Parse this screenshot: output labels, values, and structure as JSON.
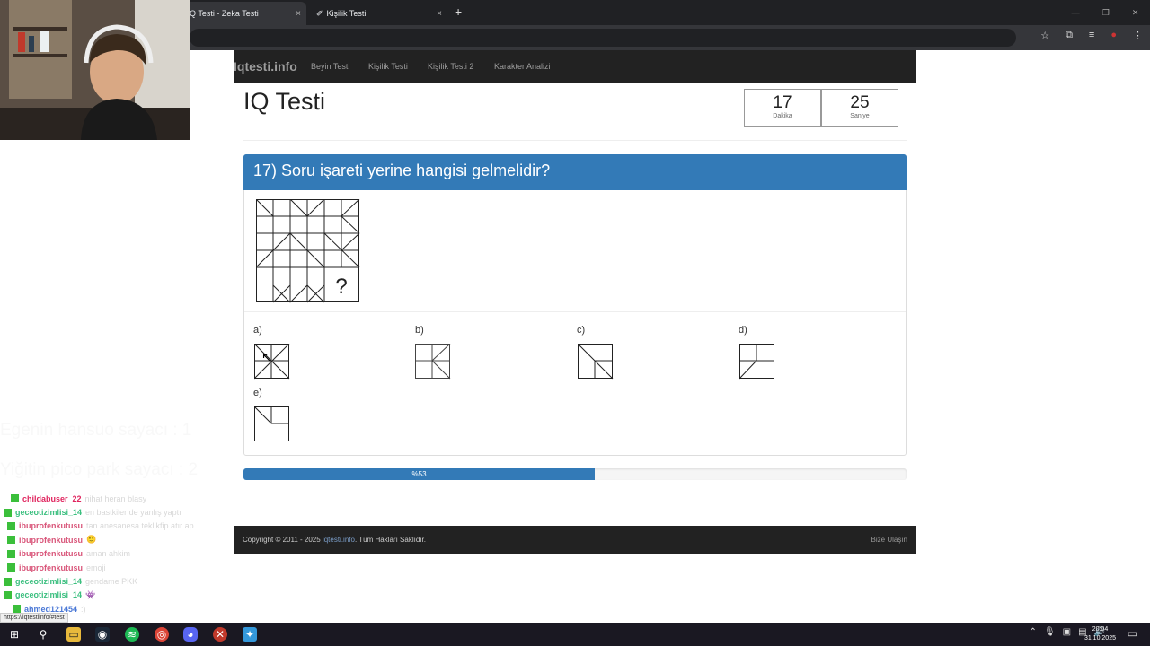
{
  "browser": {
    "tabs": [
      {
        "label": "Q Testi - Zeka Testi",
        "close": "×"
      },
      {
        "label": "Kişilik Testi",
        "close": "×"
      }
    ],
    "new_tab": "+",
    "status_url": "https://iqtestiinfo/#test"
  },
  "nav": {
    "brand": "Iqtesti.info",
    "links": [
      "Beyin Testi",
      "Kişilik Testi",
      "Kişilik Testi 2",
      "Karakter Analizi"
    ]
  },
  "page": {
    "title": "IQ Testi",
    "timer": {
      "minutes": "17",
      "minutes_label": "Dakika",
      "seconds": "25",
      "seconds_label": "Saniye"
    },
    "question": {
      "heading": "17) Soru işareti yerine hangisi gelmelidir?",
      "missing_mark": "?"
    },
    "options": [
      {
        "label": "a)"
      },
      {
        "label": "b)"
      },
      {
        "label": "c)"
      },
      {
        "label": "d)"
      },
      {
        "label": "e)"
      }
    ],
    "progress": {
      "value": 0.53,
      "label": "%53"
    }
  },
  "footer": {
    "copyright_prefix": "Copyright © 2011 - 2025",
    "site_link": "iqtesti.info",
    "copyright_suffix": ". Tüm Hakları Saklıdır.",
    "contact": "Bize Ulaşın"
  },
  "stream": {
    "overlay_lines": [
      "Egenin hansuo sayacı : 1",
      "Yiğitin pico park sayacı : 2"
    ],
    "chat": [
      {
        "user": "childabuser_22",
        "color": "#e0245e",
        "msg": "nihat heran blasy"
      },
      {
        "user": "geceotizimlisi_14",
        "color": "#3bbf7f",
        "msg": "en bastkiler de yanlış yaptı"
      },
      {
        "user": "ibuprofenkutusu",
        "color": "#d9567a",
        "msg": "tan anesanesa teklikfip atır ap"
      },
      {
        "user": "ibuprofenkutusu",
        "color": "#d9567a",
        "msg": "🙂"
      },
      {
        "user": "ibuprofenkutusu",
        "color": "#d9567a",
        "msg": "aman ahkim"
      },
      {
        "user": "ibuprofenkutusu",
        "color": "#d9567a",
        "msg": "emoji"
      },
      {
        "user": "geceotizimlisi_14",
        "color": "#3bbf7f",
        "msg": "gendame PKK"
      },
      {
        "user": "geceotizimlisi_14",
        "color": "#3bbf7f",
        "msg": "👾"
      },
      {
        "user": "ahmed121454",
        "color": "#4a78d6",
        "msg": ":)"
      }
    ]
  },
  "taskbar": {
    "time": "20:04",
    "date": "31.10.2025"
  }
}
